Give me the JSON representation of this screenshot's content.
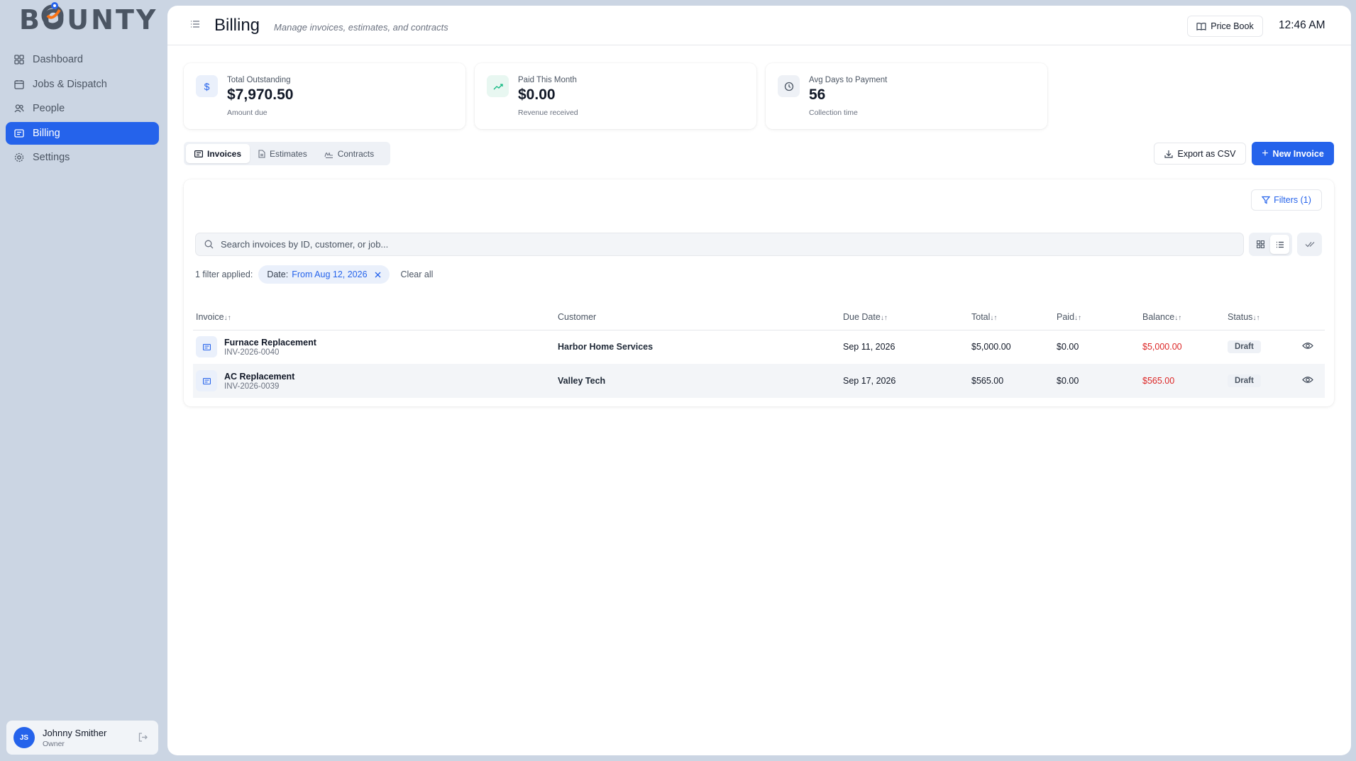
{
  "brand": {
    "logo_text_a": "B",
    "logo_text_b": "UNTY"
  },
  "sidebar": {
    "items": [
      {
        "label": "Dashboard",
        "icon": "grid-icon"
      },
      {
        "label": "Jobs & Dispatch",
        "icon": "calendar-icon"
      },
      {
        "label": "People",
        "icon": "users-icon"
      },
      {
        "label": "Billing",
        "icon": "receipt-icon",
        "active": true
      },
      {
        "label": "Settings",
        "icon": "gear-icon"
      }
    ],
    "user": {
      "initials": "JS",
      "name": "Johnny Smither",
      "role": "Owner"
    }
  },
  "header": {
    "title": "Billing",
    "subtitle": "Manage invoices, estimates, and contracts",
    "price_book_label": "Price Book",
    "time": "12:46 AM"
  },
  "stats": [
    {
      "label": "Total Outstanding",
      "value": "$7,970.50",
      "sub": "Amount due",
      "icon": "dollar-icon",
      "color": "#2563eb"
    },
    {
      "label": "Paid This Month",
      "value": "$0.00",
      "sub": "Revenue received",
      "icon": "trend-up-icon",
      "color": "#10b981"
    },
    {
      "label": "Avg Days to Payment",
      "value": "56",
      "sub": "Collection time",
      "icon": "clock-icon",
      "color": "#4b5563"
    }
  ],
  "tabs": [
    {
      "label": "Invoices",
      "active": true
    },
    {
      "label": "Estimates"
    },
    {
      "label": "Contracts"
    }
  ],
  "actions": {
    "export_label": "Export as CSV",
    "new_label": "New Invoice"
  },
  "panel": {
    "filters_label": "Filters (1)",
    "search_placeholder": "Search invoices by ID, customer, or job...",
    "filter_applied_label": "1 filter applied:",
    "chip_key": "Date:",
    "chip_value": "From Aug 12, 2026",
    "clear_all": "Clear all"
  },
  "table": {
    "columns": [
      "Invoice",
      "Customer",
      "Due Date",
      "Total",
      "Paid",
      "Balance",
      "Status"
    ],
    "rows": [
      {
        "name": "Furnace Replacement",
        "id": "INV-2026-0040",
        "customer": "Harbor Home Services",
        "due": "Sep 11, 2026",
        "total": "$5,000.00",
        "paid": "$0.00",
        "balance": "$5,000.00",
        "status": "Draft"
      },
      {
        "name": "AC Replacement",
        "id": "INV-2026-0039",
        "customer": "Valley Tech",
        "due": "Sep 17, 2026",
        "total": "$565.00",
        "paid": "$0.00",
        "balance": "$565.00",
        "status": "Draft"
      }
    ]
  },
  "colors": {
    "accent": "#2563eb",
    "danger": "#dc2626",
    "sidebar_bg": "#cbd5e3"
  }
}
